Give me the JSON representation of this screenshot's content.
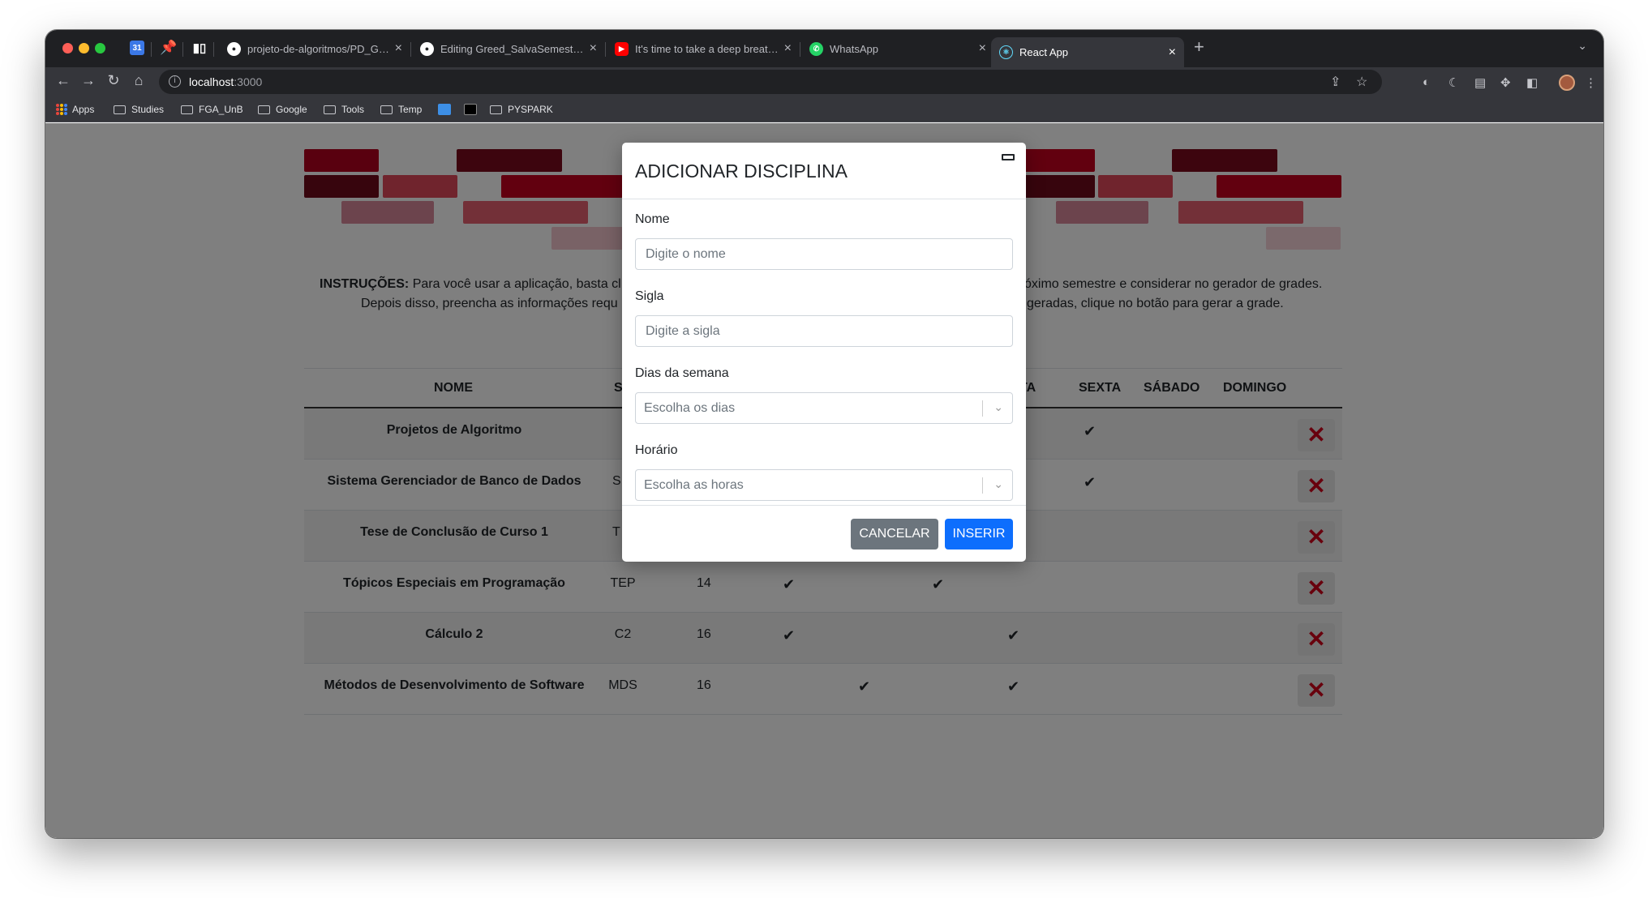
{
  "browser": {
    "tabs": [
      {
        "title": "projeto-de-algoritmos/PD_Grade"
      },
      {
        "title": "Editing Greed_SalvaSemestre/README.md"
      },
      {
        "title": "It's time to take a deep breath..."
      },
      {
        "title": "WhatsApp"
      },
      {
        "title": "React App"
      }
    ],
    "url_host": "localhost",
    "url_port": ":3000",
    "bookmarks": [
      "Apps",
      "Studies",
      "FGA_UnB",
      "Google",
      "Tools",
      "Temp",
      "PYSPARK"
    ]
  },
  "page": {
    "instructions_lead": "INSTRUÇÕES:",
    "instructions_line1_left": "Para você usar a aplicação, basta cl",
    "instructions_line1_right": "óximo semestre e considerar no gerador de grades.",
    "instructions_line2_left": "Depois disso, preencha as informações requ",
    "instructions_line2_right": "geradas, clique no botão para gerar a grade.",
    "table": {
      "headers": {
        "nome": "NOME",
        "sigla_partial": "S",
        "quinta_partial": "TA",
        "sexta": "SEXTA",
        "sabado": "SÁBADO",
        "domingo": "DOMINGO"
      },
      "check_mark": "✔",
      "delete_glyph": "✕",
      "rows": [
        {
          "name": "Projetos de Algoritmo",
          "code": "",
          "hours": ""
        },
        {
          "name": "Sistema Gerenciador de Banco de Dados",
          "code": "S",
          "hours": ""
        },
        {
          "name": "Tese de Conclusão de Curso 1",
          "code": "T",
          "hours": ""
        },
        {
          "name": "Tópicos Especiais em Programação",
          "code": "TEP",
          "hours": "14"
        },
        {
          "name": "Cálculo 2",
          "code": "C2",
          "hours": "16"
        },
        {
          "name": "Métodos de Desenvolvimento de Software",
          "code": "MDS",
          "hours": "16"
        }
      ]
    }
  },
  "modal": {
    "title": "ADICIONAR DISCIPLINA",
    "nome_label": "Nome",
    "nome_placeholder": "Digite o nome",
    "sigla_label": "Sigla",
    "sigla_placeholder": "Digite a sigla",
    "dias_label": "Dias da semana",
    "dias_placeholder": "Escolha os dias",
    "horario_label": "Horário",
    "horario_placeholder": "Escolha as horas",
    "cancel_label": "CANCELAR",
    "insert_label": "INSERIR"
  },
  "colors": {
    "brick_dark": "#5e0a1a",
    "brick_red": "#b3001e",
    "brick_rose": "#e0485a",
    "primary": "#0d6efd",
    "secondary": "#6c757d",
    "danger": "#d0021b"
  }
}
